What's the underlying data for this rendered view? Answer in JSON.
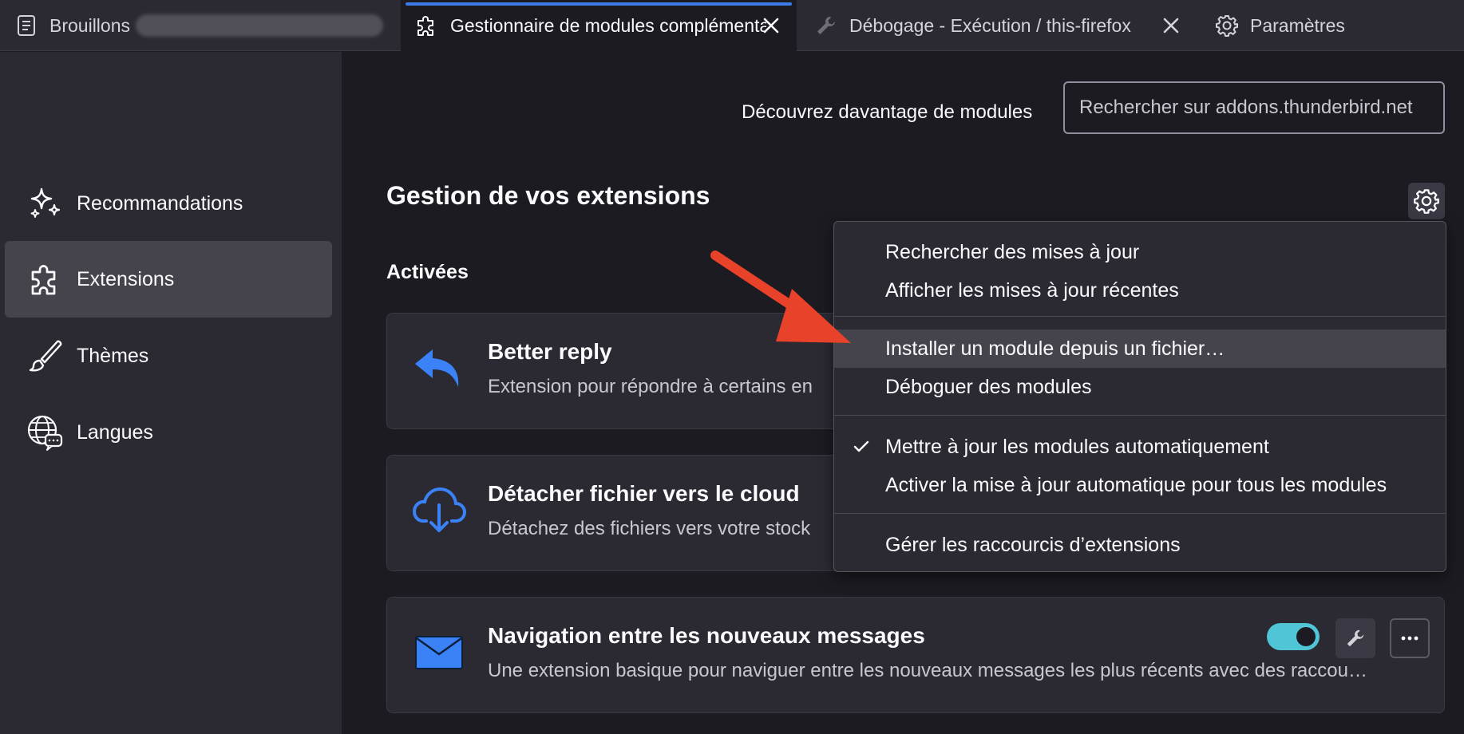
{
  "tabs": [
    {
      "label": "Brouillons",
      "icon": "document-icon"
    },
    {
      "label": "Gestionnaire de modules complémentaires",
      "icon": "puzzle-icon",
      "active": true
    },
    {
      "label": "Débogage - Exécution / this-firefox",
      "icon": "wrench-icon"
    },
    {
      "label": "Paramètres",
      "icon": "gear-icon"
    }
  ],
  "sidebar": {
    "items": [
      {
        "label": "Recommandations",
        "icon": "sparkle-icon"
      },
      {
        "label": "Extensions",
        "icon": "puzzle-icon",
        "selected": true
      },
      {
        "label": "Thèmes",
        "icon": "brush-icon"
      },
      {
        "label": "Langues",
        "icon": "globe-chat-icon"
      }
    ]
  },
  "main": {
    "discover_label": "Découvrez davantage de modules",
    "search_placeholder": "Rechercher sur addons.thunderbird.net",
    "title": "Gestion de vos extensions",
    "section_enabled": "Activées",
    "extensions": [
      {
        "name": "Better reply",
        "description": "Extension pour répondre à certains en",
        "icon": "reply-arrow-icon"
      },
      {
        "name": "Détacher fichier vers le cloud",
        "description": "Détachez des fichiers vers votre stock",
        "icon": "cloud-download-icon"
      },
      {
        "name": "Navigation entre les nouveaux messages",
        "description": "Une extension basique pour naviguer entre les nouveaux messages les plus récents avec des raccou…",
        "icon": "envelope-icon",
        "enabled": true
      }
    ]
  },
  "menu": {
    "items": [
      {
        "label": "Rechercher des mises à jour"
      },
      {
        "label": "Afficher les mises à jour récentes"
      },
      {
        "label": "Installer un module depuis un fichier…",
        "highlighted": true
      },
      {
        "label": "Déboguer des modules"
      },
      {
        "label": "Mettre à jour les modules automatiquement",
        "checked": true
      },
      {
        "label": "Activer la mise à jour automatique pour tous les modules"
      },
      {
        "label": "Gérer les raccourcis d’extensions"
      }
    ]
  },
  "colors": {
    "accent": "#3b7ce8",
    "toggle_on": "#4fc5d6",
    "annotation_arrow": "#e8422a",
    "icon_blue": "#3b82f6"
  }
}
